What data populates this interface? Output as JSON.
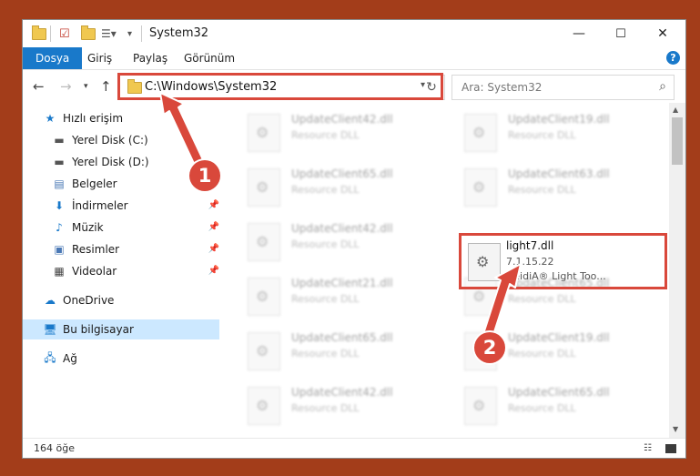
{
  "window": {
    "title": "System32",
    "minimize_icon": "—",
    "maximize_icon": "☐",
    "close_icon": "✕"
  },
  "ribbon": {
    "tabs": [
      "Dosya",
      "Giriş",
      "Paylaş",
      "Görünüm"
    ],
    "help": "?"
  },
  "address": {
    "path": "C:\\Windows\\System32",
    "search_placeholder": "Ara: System32"
  },
  "sidebar": {
    "items": [
      {
        "label": "Hızlı erişim",
        "icon": "star-icon"
      },
      {
        "label": "Yerel Disk (C:)",
        "icon": "disk-icon"
      },
      {
        "label": "Yerel Disk (D:)",
        "icon": "disk-icon"
      },
      {
        "label": "Belgeler",
        "icon": "documents-icon"
      },
      {
        "label": "İndirmeler",
        "icon": "download-icon"
      },
      {
        "label": "Müzik",
        "icon": "music-icon"
      },
      {
        "label": "Resimler",
        "icon": "pictures-icon"
      },
      {
        "label": "Videolar",
        "icon": "videos-icon"
      },
      {
        "label": "OneDrive",
        "icon": "cloud-icon"
      },
      {
        "label": "Bu bilgisayar",
        "icon": "computer-icon"
      },
      {
        "label": "Ağ",
        "icon": "network-icon"
      }
    ]
  },
  "files": [
    {
      "name": "UpdateClient42.dll",
      "desc": "Resource DLL"
    },
    {
      "name": "UpdateClient19.dll",
      "desc": "Resource DLL"
    },
    {
      "name": "UpdateClient65.dll",
      "desc": "Resource DLL"
    },
    {
      "name": "UpdateClient63.dll",
      "desc": "Resource DLL"
    },
    {
      "name": "UpdateClient42.dll",
      "desc": "Resource DLL"
    },
    {
      "name": "UpdateClient21.dll",
      "desc": "Resource DLL"
    },
    {
      "name": "UpdateClient65.dll",
      "desc": "Resource DLL"
    },
    {
      "name": "UpdateClient65.dll",
      "desc": "Resource DLL"
    },
    {
      "name": "UpdateClient19.dll",
      "desc": "Resource DLL"
    },
    {
      "name": "UpdateClient42.dll",
      "desc": "Resource DLL"
    },
    {
      "name": "UpdateClient65.dll",
      "desc": "Resource DLL"
    }
  ],
  "selected_file": {
    "name": "light7.dll",
    "version": "7.1.15.22",
    "company": "HeidiA® Light Too..."
  },
  "status": {
    "count": "164 öğe"
  },
  "callouts": [
    "1",
    "2"
  ],
  "colors": {
    "accent": "#1979ca",
    "highlight": "#d9483b",
    "selected_nav": "#cce8ff"
  }
}
